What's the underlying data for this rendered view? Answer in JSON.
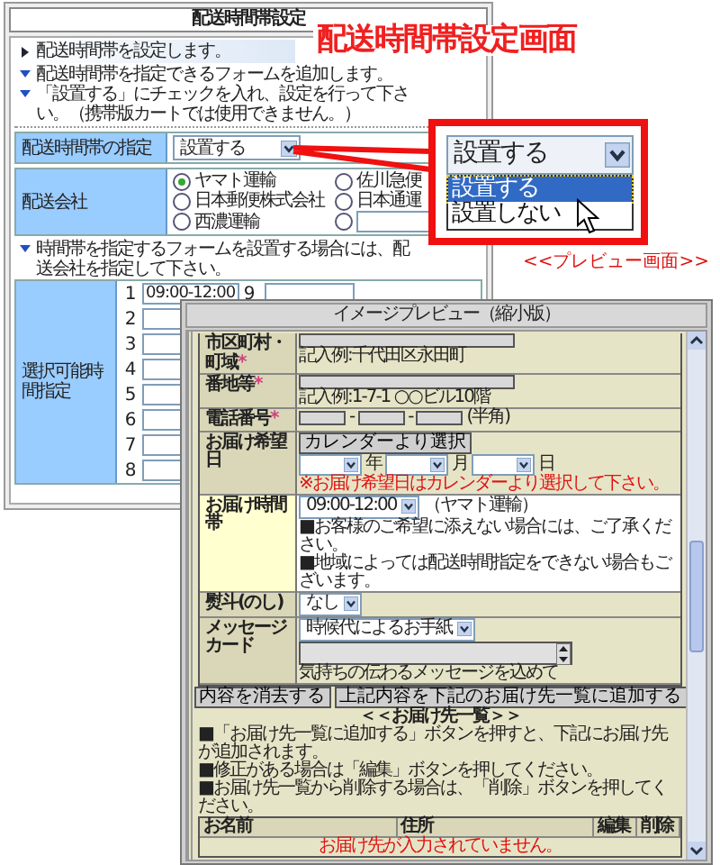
{
  "form": {
    "title": "配送時間帯設定",
    "intro": "配送時間帯を設定します。",
    "notes": [
      "配送時間帯を指定できるフォームを追加します。",
      "「設置する」にチェックを入れ、設定を行って下さい。（携帯版カートでは使用できません。）"
    ],
    "setting": {
      "label": "配送時間帯の指定",
      "value": "設置する"
    },
    "carrier": {
      "label": "配送会社",
      "options": [
        {
          "kind": "label",
          "label": "ヤマト運輸",
          "selected": true
        },
        {
          "kind": "label",
          "label": "佐川急便",
          "selected": false
        },
        {
          "kind": "label",
          "label": "日本郵便株式会社",
          "selected": false
        },
        {
          "kind": "label",
          "label": "日本通運",
          "selected": false
        },
        {
          "kind": "label",
          "label": "西濃運輸",
          "selected": false
        },
        {
          "kind": "input",
          "selected": false
        }
      ]
    },
    "carrier_note": "時間帯を指定するフォームを設置する場合には、配送会社を指定して下さい。",
    "slots": {
      "label": "選択可能時間指定",
      "columns": [
        [
          {
            "number": "1",
            "value": "09:00-12:00"
          },
          {
            "number": "2"
          },
          {
            "number": "3"
          },
          {
            "number": "4"
          },
          {
            "number": "5"
          },
          {
            "number": "6"
          },
          {
            "number": "7"
          },
          {
            "number": "8"
          }
        ],
        [
          {
            "number": "9"
          }
        ]
      ]
    }
  },
  "banner": {
    "title": "配送時間帯設定画面",
    "preview_label": "<<プレビュー画面>>"
  },
  "callout": {
    "value": "設置する",
    "options": [
      {
        "label": "設置する",
        "selected": true
      },
      {
        "label": "設置しない",
        "selected": false
      }
    ]
  },
  "preview": {
    "title": "イメージプレビュー（縮小版）",
    "rows": [
      {
        "kind": "text",
        "label": "市区町村・町域",
        "mark": "*",
        "highlighted": false,
        "hint": "記入例:千代田区永田町"
      },
      {
        "kind": "text",
        "label": "番地等",
        "mark": "*",
        "highlighted": false,
        "hint": "記入例:1-7-1 ○○ビル10階"
      },
      {
        "kind": "phone",
        "label": "電話番号",
        "mark": "*",
        "highlighted": false,
        "separators": [
          "-",
          "-"
        ],
        "hint": "(半角)"
      },
      {
        "kind": "date",
        "label": "お届け希望日",
        "highlighted": false,
        "button": "カレンダーより選択",
        "units": [
          "年",
          "月",
          "日"
        ],
        "warning": "※お届け希望日はカレンダーより選択して下さい。"
      },
      {
        "kind": "time",
        "label": "お届け時間帯",
        "highlighted": true,
        "value": "09:00-12:00",
        "carrier": "（ヤマト運輸）",
        "notes": [
          "■お客様のご希望に添えない場合には、ご了承ください。",
          "■地域によっては配送時間指定をできない場合もございます。"
        ]
      },
      {
        "kind": "select",
        "label": "熨斗(のし)",
        "highlighted": false,
        "value": "なし"
      },
      {
        "kind": "message",
        "label": "メッセージカード",
        "highlighted": false,
        "value": "時候代によるお手紙",
        "hint": "気持ちの伝わるメッセージを込めて"
      }
    ],
    "buttons": [
      "内容を消去する",
      "上記内容を下記のお届け先一覧に追加する"
    ],
    "list": {
      "heading": "＜＜お届け先一覧＞＞",
      "notes": [
        "■「お届け先一覧に追加する」ボタンを押すと、下記にお届け先が追加されます。",
        "■修正がある場合は「編集」ボタンを押してください。",
        "■お届け先一覧から削除する場合は、「削除」ボタンを押してください。"
      ],
      "columns": [
        "お名前",
        "住所",
        "編集",
        "削除"
      ],
      "empty": "お届け先が入力されていません。"
    }
  }
}
